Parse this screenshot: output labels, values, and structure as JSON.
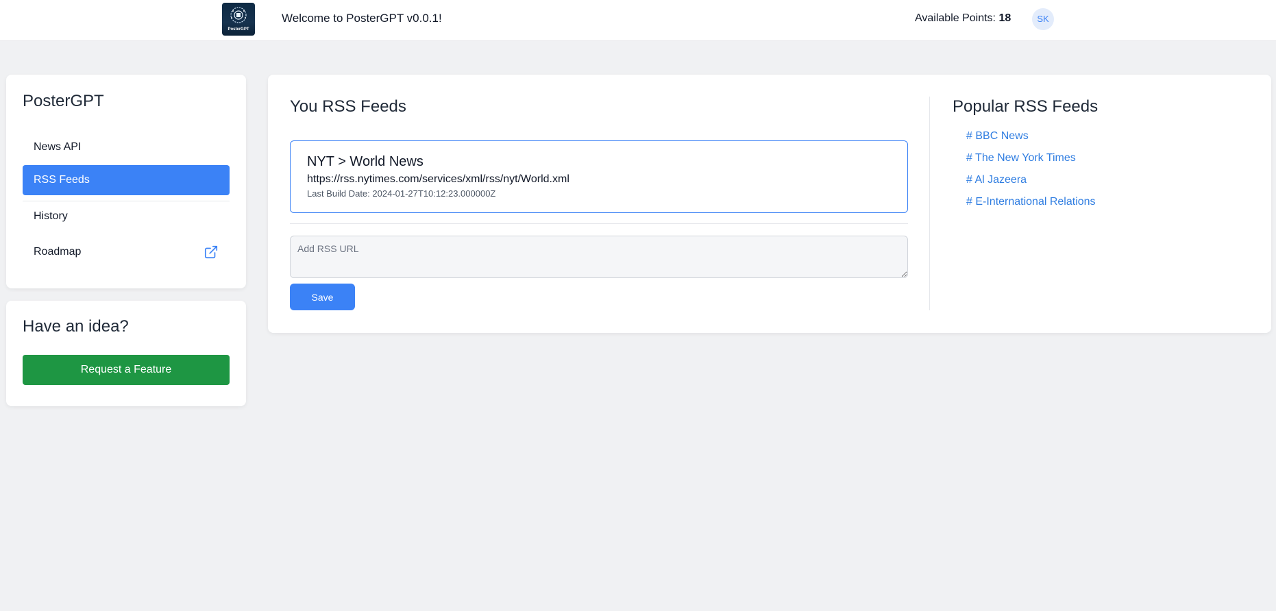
{
  "header": {
    "welcome": "Welcome to PosterGPT v0.0.1!",
    "points_label": "Available Points:",
    "points_value": "18",
    "avatar_initials": "SK",
    "logo_text": "PosterGPT"
  },
  "sidebar": {
    "title": "PosterGPT",
    "items": [
      {
        "label": "News API",
        "active": false
      },
      {
        "label": "RSS Feeds",
        "active": true
      },
      {
        "label": "History",
        "active": false
      },
      {
        "label": "Roadmap",
        "active": false,
        "icon": "external-link-icon"
      }
    ]
  },
  "idea": {
    "title": "Have an idea?",
    "button_label": "Request a Feature"
  },
  "main": {
    "title": "You RSS Feeds",
    "feeds": [
      {
        "title": "NYT > World News",
        "url": "https://rss.nytimes.com/services/xml/rss/nyt/World.xml",
        "last_build": "Last Build Date: 2024-01-27T10:12:23.000000Z"
      }
    ],
    "input_placeholder": "Add RSS URL",
    "save_label": "Save"
  },
  "popular": {
    "title": "Popular RSS Feeds",
    "items": [
      "# BBC News",
      "# The New York Times",
      "# Al Jazeera",
      "# E-International Relations"
    ]
  },
  "colors": {
    "accent": "#3b82f6",
    "success": "#1e9643",
    "link": "#2f7de1",
    "background": "#f0f1f3"
  }
}
